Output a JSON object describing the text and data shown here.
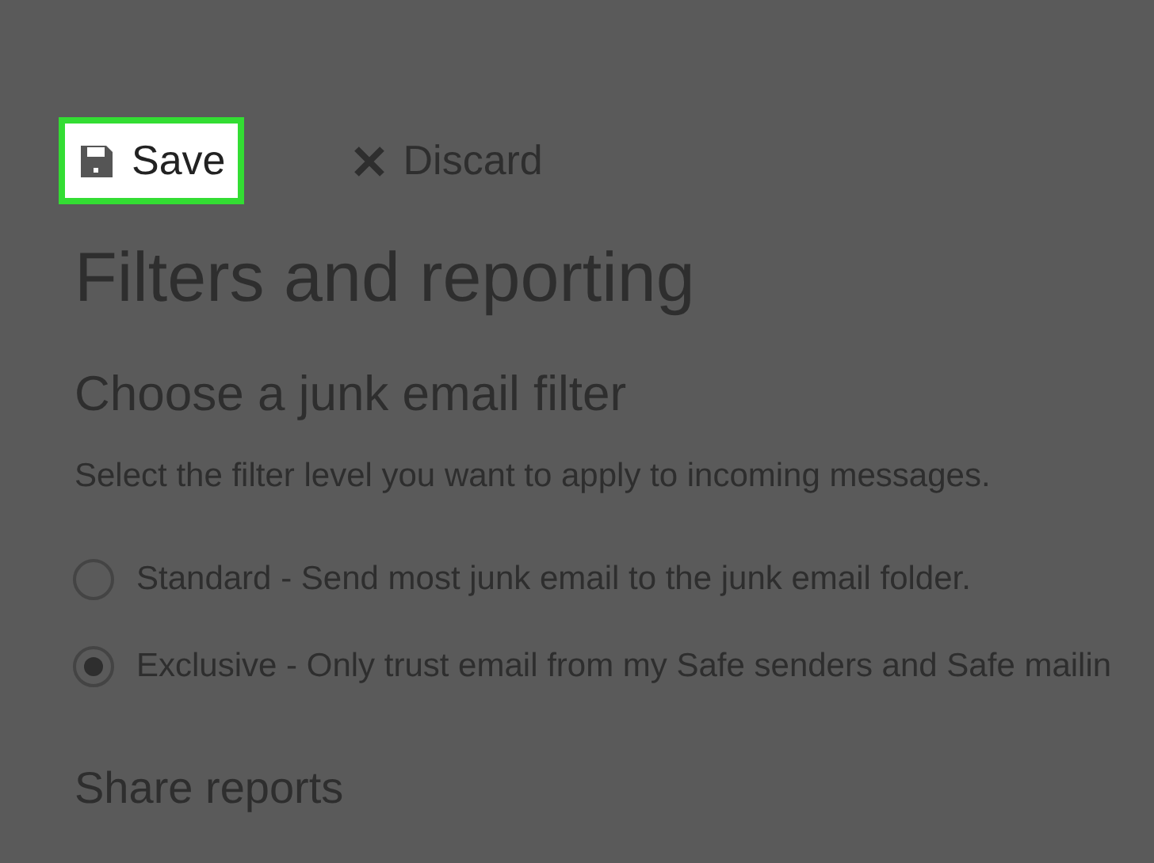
{
  "toolbar": {
    "buttons": [
      {
        "kind": "save",
        "label": "Save",
        "highlighted": true
      },
      {
        "kind": "discard",
        "label": "Discard",
        "highlighted": false
      }
    ]
  },
  "title": "Filters and reporting",
  "junk_filter": {
    "heading": "Choose a junk email filter",
    "description": "Select the filter level you want to apply to incoming messages.",
    "options": [
      {
        "label": "Standard - Send most junk email to the junk email folder.",
        "selected": false
      },
      {
        "label": "Exclusive - Only trust email from my Safe senders and Safe mailin",
        "selected": true
      }
    ]
  },
  "share_reports": {
    "heading": "Share reports"
  }
}
